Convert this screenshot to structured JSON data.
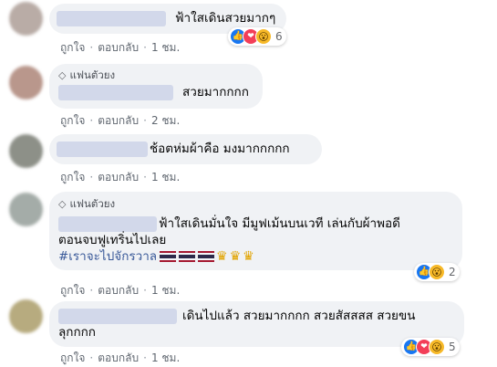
{
  "comments": [
    {
      "text": "ฟ้าใสเดินสวยมากๆ",
      "like": "ถูกใจ",
      "reply": "ตอบกลับ",
      "time": "1 ชม.",
      "reaction_count": "6",
      "reactions": [
        "like-icon",
        "love-icon",
        "wow-icon"
      ],
      "avatar_color": "#b9aca6"
    },
    {
      "badge": "แฟนตัวยง",
      "text": "สวยมากกกก",
      "like": "ถูกใจ",
      "reply": "ตอบกลับ",
      "time": "2 ชม.",
      "avatar_color": "#b9978c"
    },
    {
      "text": "ช้อตห่มผ้าคือ มงมากกกกก",
      "like": "ถูกใจ",
      "reply": "ตอบกลับ",
      "time": "1 ชม.",
      "avatar_color": "#8d9088"
    },
    {
      "badge": "แฟนตัวยง",
      "line1": "ฟ้าใสเดินมั่นใจ มีมูฟเม้นบนเวที เล่นกับผ้าพอดี",
      "line2": "ตอนจบฟูเทริ่นไปเลย",
      "hashtag": "#เราจะไปจักรวาล",
      "like": "ถูกใจ",
      "reply": "ตอบกลับ",
      "time": "1 ชม.",
      "reaction_count": "2",
      "reactions": [
        "like-icon",
        "wow-icon"
      ],
      "avatar_color": "#a4aca8"
    },
    {
      "line1": "เดินไปแล้ว สวยมากกกก สวยสัสสสส สวยขน",
      "line2": "ลุกกกก",
      "like": "ถูกใจ",
      "reply": "ตอบกลับ",
      "time": "1 ชม.",
      "reaction_count": "5",
      "reactions": [
        "like-icon",
        "love-icon",
        "wow-icon"
      ],
      "avatar_color": "#b7ab7f"
    }
  ],
  "separator": "·",
  "colors": {
    "link": "#385898",
    "bubble": "#f0f2f5",
    "like": "#1877f2",
    "love": "#f33e58",
    "wow": "#f7b928"
  }
}
